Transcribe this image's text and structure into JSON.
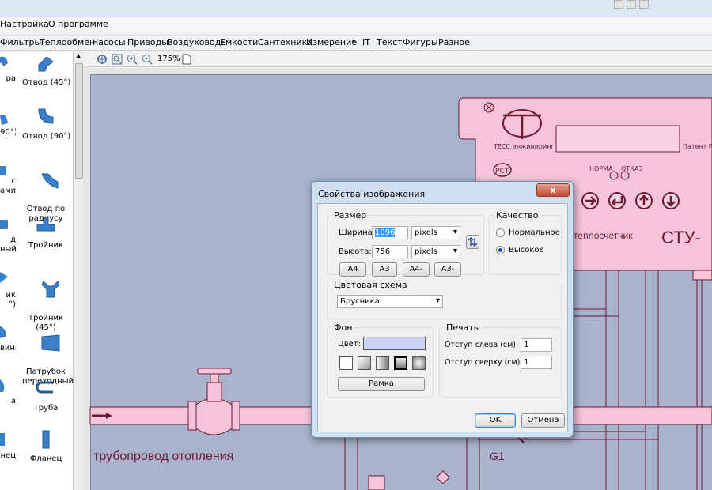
{
  "window": {
    "menu": [
      "Настройка",
      "О программе"
    ]
  },
  "categories": [
    "Фильтры",
    "Теплообмен",
    "Насосы",
    "Приводы",
    "Воздуховоды",
    "Емкости",
    "Сантехника",
    "Измерение",
    "IT",
    "Текст",
    "Фигуры",
    "Разное"
  ],
  "palette": {
    "items": [
      {
        "label": "Отвод (45°)",
        "icon": "elbow-45-icon"
      },
      {
        "label": "Отвод (90°)",
        "icon": "elbow-90-icon"
      },
      {
        "label": "Отвод по\nрадиусу",
        "icon": "radius-elbow-icon"
      },
      {
        "label": "Тройник",
        "icon": "tee-icon"
      },
      {
        "label": "Тройник\n(45°)",
        "icon": "tee-45-icon"
      },
      {
        "label": "Патрубок\nпереходный",
        "icon": "reducer-icon"
      },
      {
        "label": "Труба",
        "icon": "pipe-icon"
      },
      {
        "label": "Фланец",
        "icon": "flange-icon"
      }
    ],
    "cut_labels": [
      "ра",
      "90°)",
      "с\nами",
      "д\nный",
      "ик\n°)",
      "вина",
      "а",
      "нец"
    ]
  },
  "toolbar": {
    "zoom": "175%"
  },
  "canvas": {
    "device": {
      "brand": "ТЕСС инжиниринг",
      "patent": "Патент Р",
      "norma": "НОРМА",
      "otkaz": "ОТКАЗ",
      "model_prefix": "й теплосчетчик",
      "model": "СТУ-"
    },
    "pipe_label": "трубопровод отопления",
    "g1_label": "G1"
  },
  "dialog": {
    "title": "Свойства изображения",
    "close": "x",
    "size_group": "Размер",
    "width_label": "Ширина:",
    "width_value": "1096",
    "width_unit": "pixels",
    "height_label": "Высота:",
    "height_value": "756",
    "height_unit": "pixels",
    "presets": [
      "A4",
      "A3",
      "A4-",
      "A3-"
    ],
    "quality_group": "Качество",
    "quality_options": [
      "Нормальное",
      "Высокое"
    ],
    "quality_selected": "Высокое",
    "scheme_group": "Цветовая схема",
    "scheme_value": "Брусника",
    "bg_group": "Фон",
    "color_label": "Цвет:",
    "bg_color": "#c8d4f2",
    "frame_button": "Рамка",
    "print_group": "Печать",
    "left_margin_label": "Отступ слева (см):",
    "left_margin_value": "1",
    "top_margin_label": "Отступ сверху (см):",
    "top_margin_value": "1",
    "ok": "OK",
    "cancel": "Отмена"
  },
  "colors": {
    "canvas_bg": "#a9b3cd",
    "schematic_fill": "#f5c4d8",
    "schematic_line": "#6e1a34",
    "dialog_frame": "#cfe0f1",
    "accent_blue": "#3c7fd0"
  }
}
